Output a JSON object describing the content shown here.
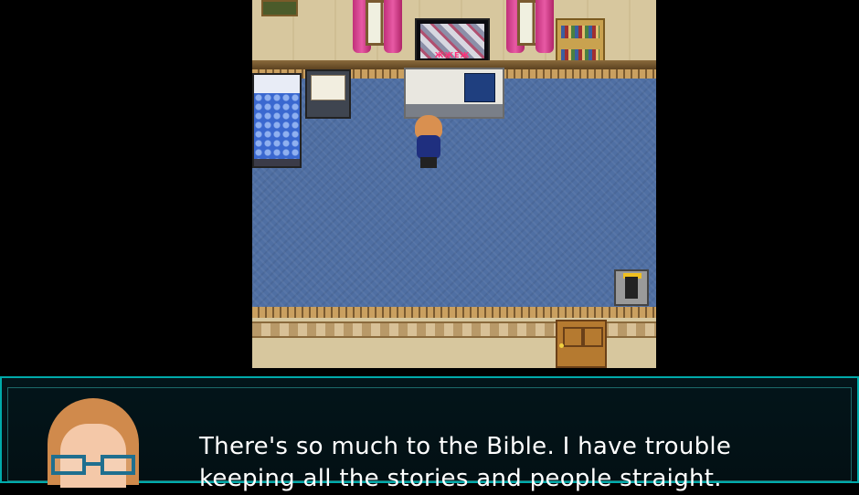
{
  "dialog": {
    "line1": "There's so much to the Bible. I have trouble",
    "line2": "keeping all the stories and people straight."
  },
  "tv": {
    "screen_text": "ЖЖЕЖ"
  },
  "colors": {
    "floor": "#4f6fa3",
    "wall": "#d7c79e",
    "message_border": "#00aaaa",
    "curtain": "#e85aa5"
  }
}
